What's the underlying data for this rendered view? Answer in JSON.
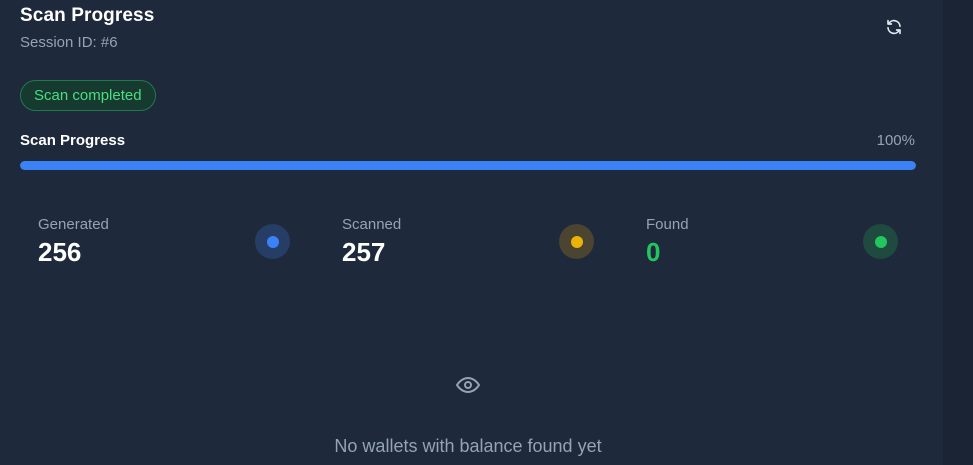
{
  "header": {
    "title": "Scan Progress",
    "session": "Session ID: #6"
  },
  "status": {
    "badge": "Scan completed",
    "badge_color": "#4ade80"
  },
  "progress": {
    "label": "Scan Progress",
    "percent_text": "100%",
    "value": 100,
    "color": "#3b82f6"
  },
  "stats": [
    {
      "label": "Generated",
      "value": "256",
      "icon": "blue-dot-icon",
      "color": "#3b82f6",
      "bg": "#263d66"
    },
    {
      "label": "Scanned",
      "value": "257",
      "icon": "yellow-dot-icon",
      "color": "#eab308",
      "bg": "#4a4430"
    },
    {
      "label": "Found",
      "value": "0",
      "icon": "green-dot-icon",
      "color": "#22c55e",
      "bg": "#1f4a3f"
    }
  ],
  "empty_state": {
    "icon": "eye-icon",
    "message": "No wallets with balance found yet"
  },
  "icons": {
    "refresh": "refresh-icon"
  }
}
